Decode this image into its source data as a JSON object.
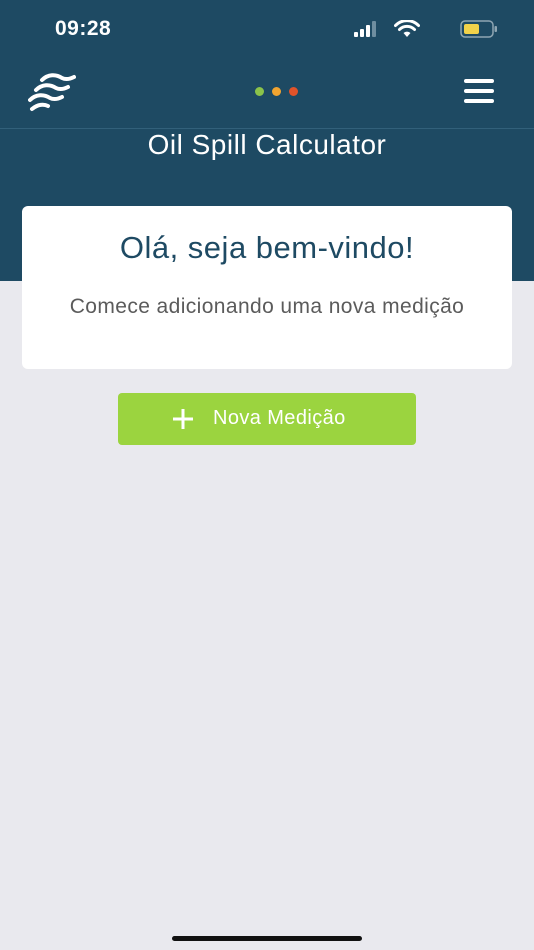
{
  "status_bar": {
    "time": "09:28",
    "battery_color": "#f2d24a"
  },
  "header": {
    "background_color": "#1e4a63",
    "logo_icon": "wave-logo-icon",
    "indicator_colors": [
      "#8bc34a",
      "#f0a430",
      "#e0532a"
    ],
    "menu_icon": "hamburger-menu-icon",
    "title": "Oil Spill Calculator"
  },
  "welcome": {
    "title": "Olá, seja bem-vindo!",
    "subtitle": "Comece adicionando uma nova medição"
  },
  "actions": {
    "new_measurement_label": "Nova Medição",
    "new_measurement_icon": "plus-icon",
    "accent_color": "#9bd43f"
  }
}
